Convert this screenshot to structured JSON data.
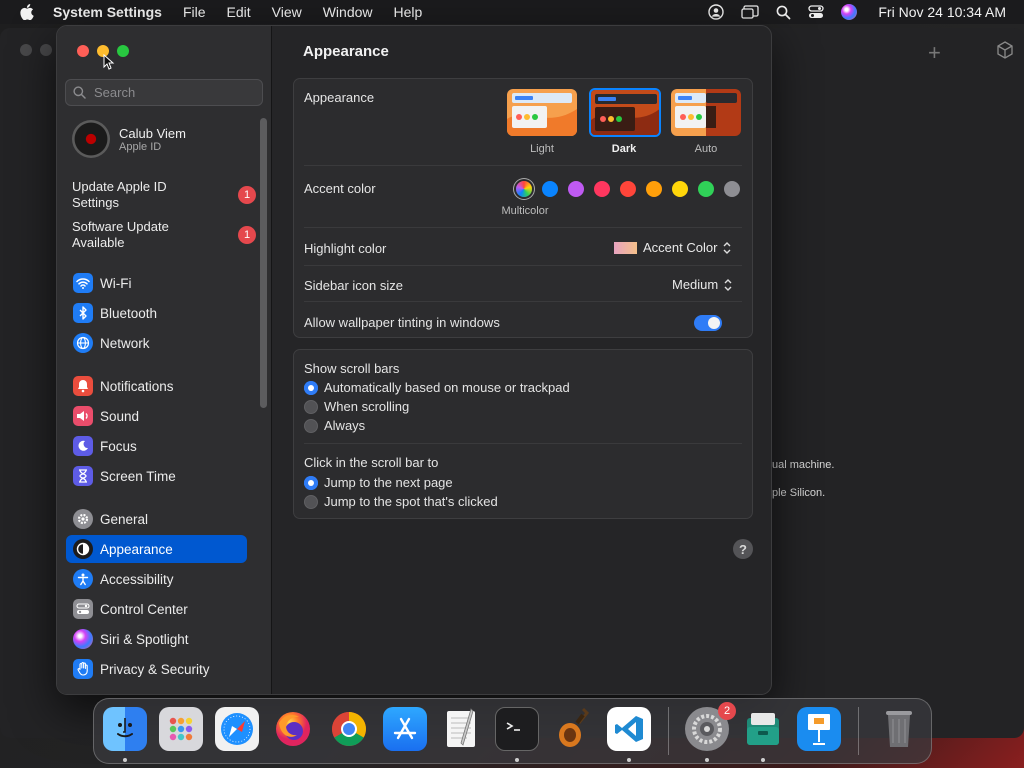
{
  "menubar": {
    "app_name": "System Settings",
    "items": [
      "File",
      "Edit",
      "View",
      "Window",
      "Help"
    ],
    "clock": "Fri Nov 24  10:34 AM"
  },
  "background_window": {
    "text_line1": "ual machine.",
    "text_line2": "ple Silicon."
  },
  "sidebar": {
    "search_placeholder": "Search",
    "profile": {
      "name": "Calub Viem",
      "subtitle": "Apple ID"
    },
    "notifications": [
      {
        "line1": "Update Apple ID",
        "line2": "Settings",
        "badge": "1"
      },
      {
        "line1": "Software Update",
        "line2": "Available",
        "badge": "1"
      }
    ],
    "items": [
      {
        "label": "Wi-Fi",
        "icon": "wifi-icon",
        "color": "#1f7cf5"
      },
      {
        "label": "Bluetooth",
        "icon": "bluetooth-icon",
        "color": "#1f7cf5"
      },
      {
        "label": "Network",
        "icon": "globe-icon",
        "color": "#1f7cf5"
      },
      {
        "label": "Notifications",
        "icon": "bell-icon",
        "color": "#ea4d3d"
      },
      {
        "label": "Sound",
        "icon": "speaker-icon",
        "color": "#ea4d6b"
      },
      {
        "label": "Focus",
        "icon": "moon-icon",
        "color": "#5e5ce6"
      },
      {
        "label": "Screen Time",
        "icon": "hourglass-icon",
        "color": "#5e5ce6"
      },
      {
        "label": "General",
        "icon": "gear-icon",
        "color": "#8e8e93"
      },
      {
        "label": "Appearance",
        "icon": "appearance-icon",
        "color": "#1c1c1e",
        "selected": true
      },
      {
        "label": "Accessibility",
        "icon": "accessibility-icon",
        "color": "#1f7cf5"
      },
      {
        "label": "Control Center",
        "icon": "control-center-icon",
        "color": "#8e8e93"
      },
      {
        "label": "Siri & Spotlight",
        "icon": "siri-icon",
        "color": "#7b3fe4"
      },
      {
        "label": "Privacy & Security",
        "icon": "hand-icon",
        "color": "#1f7cf5"
      }
    ]
  },
  "content": {
    "title": "Appearance",
    "appearance": {
      "label": "Appearance",
      "options": [
        {
          "label": "Light",
          "selected": false
        },
        {
          "label": "Dark",
          "selected": true
        },
        {
          "label": "Auto",
          "selected": false
        }
      ]
    },
    "accent": {
      "label": "Accent color",
      "selected_label": "Multicolor",
      "colors": [
        "#0a84ff",
        "#bf5af2",
        "#ff375f",
        "#ff453a",
        "#ff9f0a",
        "#ffd60a",
        "#30d158",
        "#8e8e93"
      ]
    },
    "highlight": {
      "label": "Highlight color",
      "value": "Accent Color"
    },
    "sidebar_icon_size": {
      "label": "Sidebar icon size",
      "value": "Medium"
    },
    "wallpaper_tinting": {
      "label": "Allow wallpaper tinting in windows",
      "enabled": true
    },
    "scroll_bars": {
      "label": "Show scroll bars",
      "options": [
        {
          "label": "Automatically based on mouse or trackpad",
          "selected": true
        },
        {
          "label": "When scrolling",
          "selected": false
        },
        {
          "label": "Always",
          "selected": false
        }
      ]
    },
    "click_scroll": {
      "label": "Click in the scroll bar to",
      "options": [
        {
          "label": "Jump to the next page",
          "selected": true
        },
        {
          "label": "Jump to the spot that's clicked",
          "selected": false
        }
      ]
    },
    "help_label": "?"
  },
  "dock": {
    "apps": [
      "finder-icon",
      "launchpad-icon",
      "safari-icon",
      "firefox-icon",
      "chrome-icon",
      "app-store-icon",
      "textedit-icon",
      "terminal-icon",
      "garageband-icon",
      "vscode-icon",
      "system-settings-icon",
      "archive-utility-icon",
      "keynote-icon",
      "trash-icon"
    ],
    "system_settings_badge": "2"
  }
}
